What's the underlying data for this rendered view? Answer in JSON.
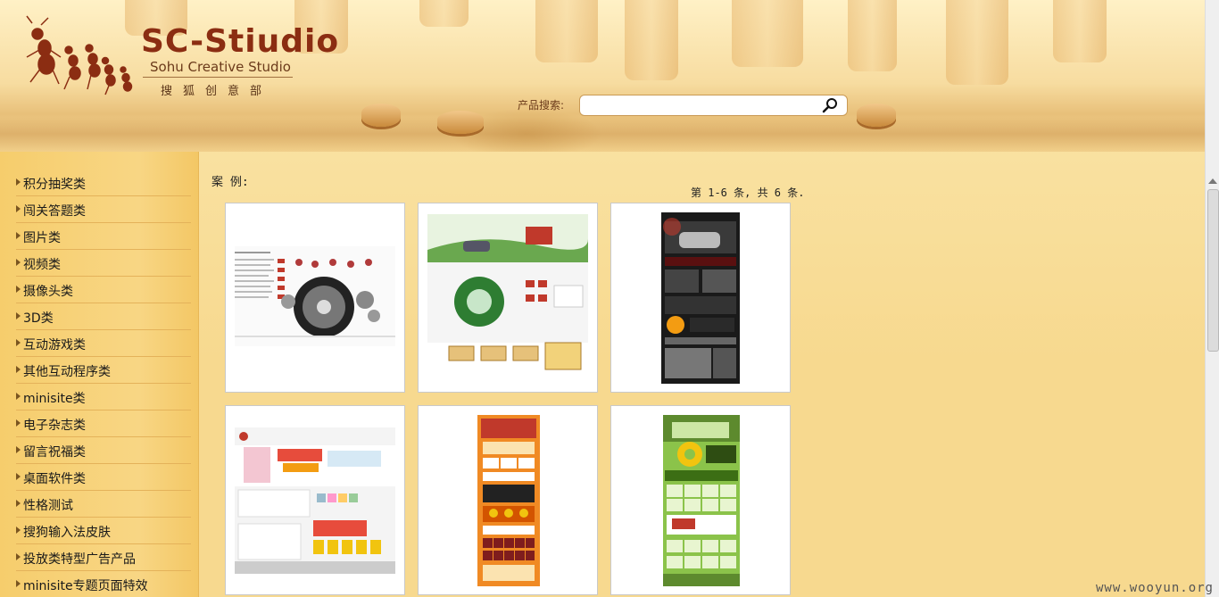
{
  "header": {
    "logo_title": "SC-Stiudio",
    "logo_subtitle": "Sohu Creative Studio",
    "logo_cn": "搜狐创意部",
    "search": {
      "label": "产品搜索:",
      "value": "",
      "placeholder": ""
    }
  },
  "sidebar": {
    "items": [
      {
        "label": "积分抽奖类"
      },
      {
        "label": "闯关答题类"
      },
      {
        "label": "图片类"
      },
      {
        "label": "视频类"
      },
      {
        "label": "摄像头类"
      },
      {
        "label": "3D类"
      },
      {
        "label": "互动游戏类"
      },
      {
        "label": "其他互动程序类"
      },
      {
        "label": "minisite类"
      },
      {
        "label": "电子杂志类"
      },
      {
        "label": "留言祝福类"
      },
      {
        "label": "桌面软件类"
      },
      {
        "label": "性格测试"
      },
      {
        "label": "搜狗输入法皮肤"
      },
      {
        "label": "投放类特型广告产品"
      },
      {
        "label": "minisite专题页面特效"
      }
    ]
  },
  "main": {
    "section_label": "案 例:",
    "count_text": "第 1-6 条, 共 6 条.",
    "cases": [
      {
        "name": "tire-promo"
      },
      {
        "name": "green-car-site"
      },
      {
        "name": "dark-car-site"
      },
      {
        "name": "bank-promo"
      },
      {
        "name": "orange-event"
      },
      {
        "name": "green-game"
      }
    ]
  },
  "watermark": "www.wooyun.org",
  "colors": {
    "brand": "#8b2d12",
    "sidebar": "#f6cd6c",
    "background": "#f8df8f"
  }
}
